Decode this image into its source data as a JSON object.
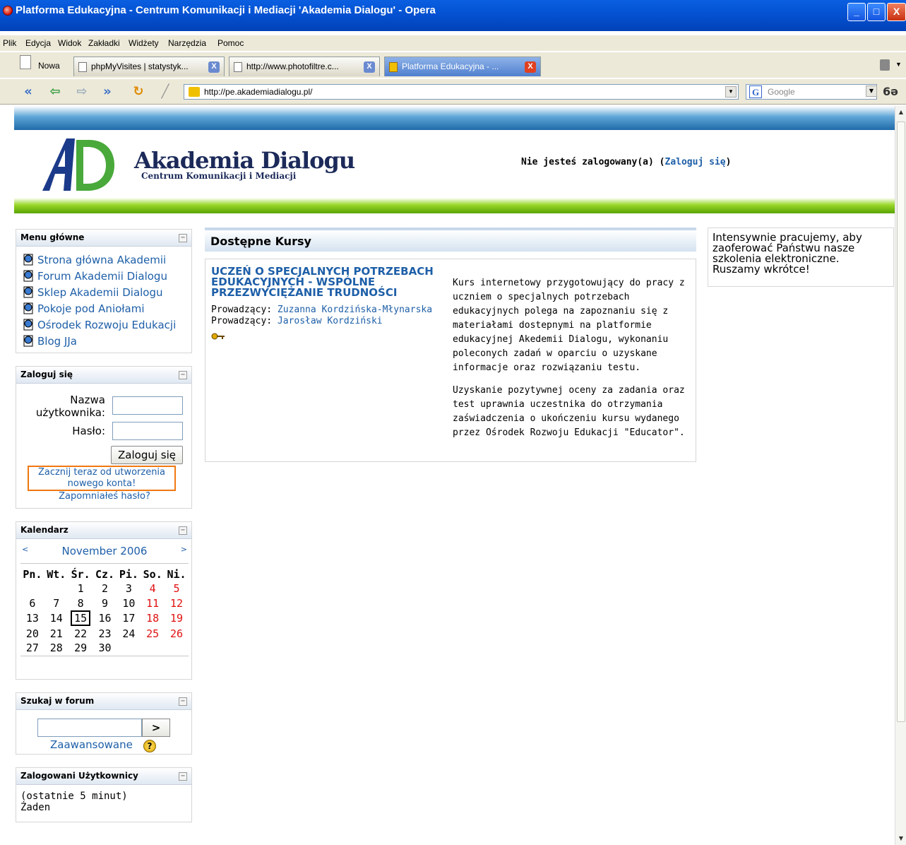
{
  "window": {
    "title": "Platforma Edukacyjna - Centrum Komunikacji i Mediacji 'Akademia Dialogu' - Opera",
    "minimize": "_",
    "maximize": "□",
    "close": "X"
  },
  "menubar": [
    "Plik",
    "Edycja",
    "Widok",
    "Zakładki",
    "Widżety",
    "Narzędzia",
    "Pomoc"
  ],
  "tabs": {
    "new_label": "Nowa",
    "items": [
      {
        "label": "phpMyVisites | statystyk..."
      },
      {
        "label": "http://www.photofiltre.c..."
      },
      {
        "label": "Platforma Edukacyjna - ..."
      }
    ],
    "close_glyph": "X"
  },
  "address": {
    "url": "http://pe.akademiadialogu.pl/"
  },
  "search": {
    "engine_glyph": "G",
    "placeholder": "Google"
  },
  "nav_glyphs": {
    "rewind": "«",
    "back": "⇦",
    "forward": "⇨",
    "fastforward": "»",
    "reload": "↻",
    "edit": "╱"
  },
  "site": {
    "logo_title": "Akademia Dialogu",
    "logo_subtitle": "Centrum Komunikacji i Mediacji",
    "login_status_prefix": "Nie jesteś zalogowany(a) (",
    "login_status_link": "Zaloguj się",
    "login_status_suffix": ")"
  },
  "menu_block": {
    "title": "Menu główne",
    "items": [
      "Strona główna Akademii",
      "Forum Akademii Dialogu",
      "Sklep Akademii Dialogu",
      "Pokoje pod Aniołami",
      "Ośrodek Rozwoju Edukacji",
      "Blog JJa"
    ]
  },
  "login_block": {
    "title": "Zaloguj się",
    "username_label_1": "Nazwa",
    "username_label_2": "użytkownika:",
    "password_label": "Hasło:",
    "button": "Zaloguj się",
    "signup_link_1": "Zacznij teraz od utworzenia",
    "signup_link_2": "nowego konta!",
    "forgot_link": "Zapomniałeś hasło?"
  },
  "calendar": {
    "title": "Kalendarz",
    "prev": "<",
    "next": ">",
    "month": "November 2006",
    "weekdays": [
      "Pn.",
      "Wt.",
      "Śr.",
      "Cz.",
      "Pi.",
      "So.",
      "Ni."
    ],
    "weeks": [
      [
        "",
        "",
        "1",
        "2",
        "3",
        "4",
        "5"
      ],
      [
        "6",
        "7",
        "8",
        "9",
        "10",
        "11",
        "12"
      ],
      [
        "13",
        "14",
        "15",
        "16",
        "17",
        "18",
        "19"
      ],
      [
        "20",
        "21",
        "22",
        "23",
        "24",
        "25",
        "26"
      ],
      [
        "27",
        "28",
        "29",
        "30",
        "",
        "",
        ""
      ]
    ],
    "today": "15"
  },
  "forum_search": {
    "title": "Szukaj w forum",
    "go": ">",
    "advanced": "Zaawansowane",
    "help_glyph": "?"
  },
  "users_block": {
    "title": "Zalogowani Użytkownicy",
    "line1": "(ostatnie 5 minut)",
    "line2": "Żaden"
  },
  "main": {
    "heading": "Dostępne Kursy",
    "course": {
      "title": "UCZEŃ O SPECJALNYCH POTRZEBACH EDUKACYJNYCH - WSPÓLNE PRZEZWYCIĘŻANIE TRUDNOŚCI",
      "teacher_label": "Prowadzący:",
      "teachers": [
        "Zuzanna Kordzińska-Młynarska",
        "Jarosław Kordziński"
      ],
      "desc1": "Kurs internetowy przygotowujący do pracy z uczniem o specjalnych potrzebach edukacyjnych polega na zapoznaniu się z materiałami dostepnymi na platformie edukacyjnej Akedemii Dialogu, wykonaniu poleconych zadań w oparciu o uzyskane informacje oraz rozwiązaniu testu.",
      "desc2": "Uzyskanie pozytywnej oceny za zadania oraz test uprawnia uczestnika do otrzymania zaświadczenia o ukończeniu kursu wydanego przez Ośrodek Rozwoju Edukacji \"Educator\"."
    }
  },
  "info_box": {
    "text": "Intensywnie pracujemy, aby zaoferować Państwu nasze szkolenia elektroniczne. Ruszamy wkrótce!"
  },
  "colors": {
    "link": "#1e5fa8",
    "weekend": "#e01010",
    "highlight_border": "#f07810",
    "top_stripe": "#1f6aa8",
    "green_stripe": "#5aa300"
  }
}
